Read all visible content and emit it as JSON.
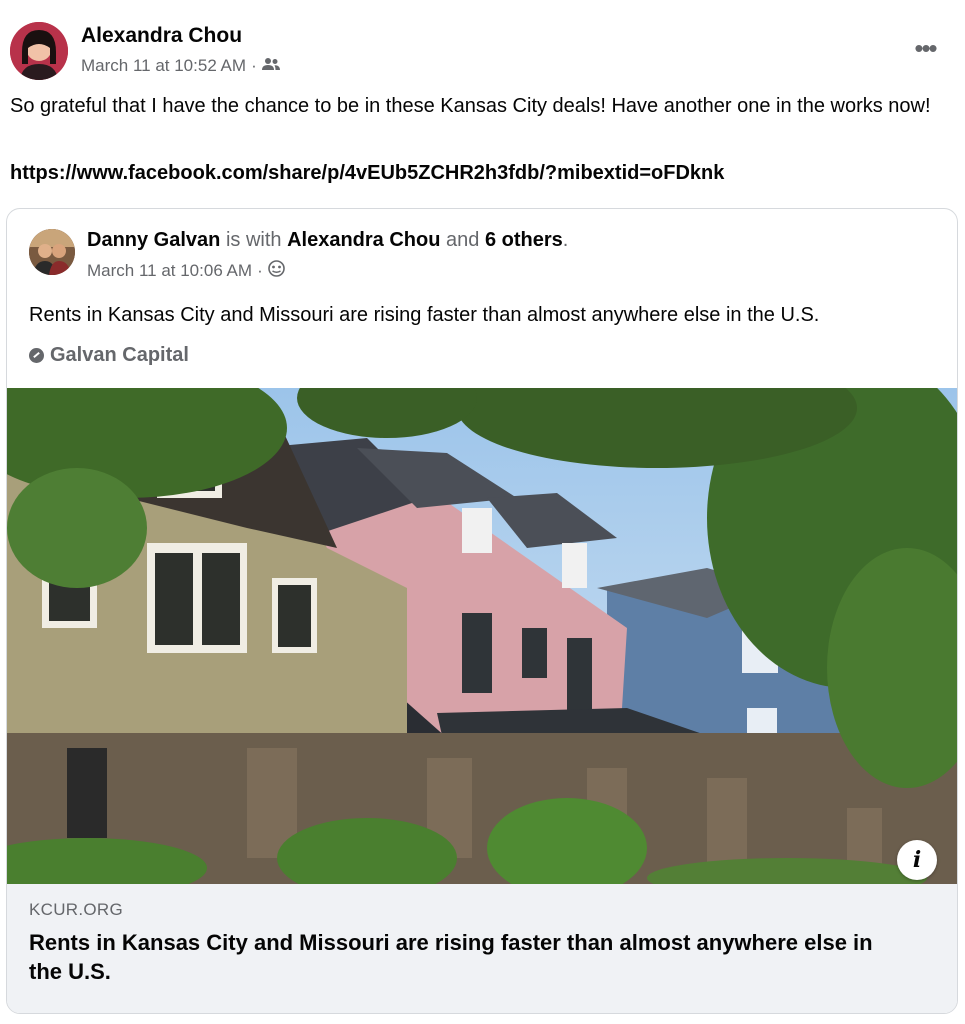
{
  "post": {
    "author": "Alexandra Chou",
    "timestamp": "March 11 at 10:52 AM",
    "separator": "·",
    "audience_icon": "friends-icon",
    "more_label": "•••",
    "text": "So grateful that I have the chance to be in these Kansas City deals! Have another one in the works now!",
    "link": "https://www.facebook.com/share/p/4vEUb5ZCHR2h3fdb/?mibextid=oFDknk"
  },
  "shared": {
    "author": "Danny Galvan",
    "is_with": "is with",
    "tagged": "Alexandra Chou",
    "and": "and",
    "others": "6 others",
    "period": ".",
    "timestamp": "March 11 at 10:06 AM",
    "separator": "·",
    "audience_icon": "custom-audience-icon",
    "text": "Rents in Kansas City and Missouri are rising faster than almost anywhere else in the U.S.",
    "page_tag": "Galvan Capital",
    "info_label": "i"
  },
  "link_preview": {
    "domain": "KCUR.ORG",
    "title": "Rents in Kansas City and Missouri are rising faster than almost anywhere else in the U.S."
  },
  "colors": {
    "text": "#050505",
    "secondary": "#65676b",
    "preview_bg": "#f0f2f5",
    "border": "#d6d9dd"
  }
}
